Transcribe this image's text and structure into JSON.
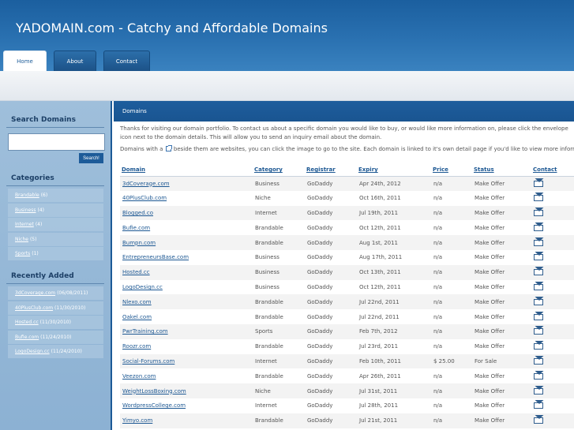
{
  "header": {
    "title": "YADOMAIN.com - Catchy and Affordable Domains",
    "tabs": [
      {
        "label": "Home",
        "active": true
      },
      {
        "label": "About",
        "active": false
      },
      {
        "label": "Contact",
        "active": false
      }
    ]
  },
  "sidebar": {
    "search": {
      "heading": "Search Domains",
      "placeholder": "",
      "button_label": "Search!"
    },
    "categories": {
      "heading": "Categories",
      "items": [
        {
          "label": "Brandable",
          "count": "(6)"
        },
        {
          "label": "Business",
          "count": "(4)"
        },
        {
          "label": "Internet",
          "count": "(4)"
        },
        {
          "label": "Niche",
          "count": "(5)"
        },
        {
          "label": "Sports",
          "count": "(1)"
        }
      ]
    },
    "recent": {
      "heading": "Recently Added",
      "items": [
        {
          "label": "3dCoverage.com",
          "date": "(06/08/2011)"
        },
        {
          "label": "40PlusClub.com",
          "date": "(11/30/2010)"
        },
        {
          "label": "Hosted.cc",
          "date": "(11/30/2010)"
        },
        {
          "label": "Bufie.com",
          "date": "(11/24/2010)"
        },
        {
          "label": "LogoDesign.cc",
          "date": "(11/24/2010)"
        }
      ]
    }
  },
  "main": {
    "bar_title": "Domains",
    "intro": "Thanks for visiting our domain portfolio. To contact us about a specific domain you would like to buy, or would like more information on, please click the envelope icon next to the domain details. This will allow you to send an inquiry email about the domain.",
    "note_before": "Domains with a",
    "note_after": "beside them are websites, you can click the image to go to the site. Each domain is linked to it's own detail page if you'd like to view more information.",
    "columns": [
      "Domain",
      "Category",
      "Registrar",
      "Expiry",
      "Price",
      "Status",
      "Contact"
    ],
    "rows": [
      {
        "domain": "3dCoverage.com",
        "category": "Business",
        "registrar": "GoDaddy",
        "expiry": "Apr 24th, 2012",
        "price": "n/a",
        "status": "Make Offer"
      },
      {
        "domain": "40PlusClub.com",
        "category": "Niche",
        "registrar": "GoDaddy",
        "expiry": "Oct 16th, 2011",
        "price": "n/a",
        "status": "Make Offer"
      },
      {
        "domain": "Blogged.co",
        "category": "Internet",
        "registrar": "GoDaddy",
        "expiry": "Jul 19th, 2011",
        "price": "n/a",
        "status": "Make Offer"
      },
      {
        "domain": "Bufie.com",
        "category": "Brandable",
        "registrar": "GoDaddy",
        "expiry": "Oct 12th, 2011",
        "price": "n/a",
        "status": "Make Offer"
      },
      {
        "domain": "Bumpn.com",
        "category": "Brandable",
        "registrar": "GoDaddy",
        "expiry": "Aug 1st, 2011",
        "price": "n/a",
        "status": "Make Offer"
      },
      {
        "domain": "EntrepreneursBase.com",
        "category": "Business",
        "registrar": "GoDaddy",
        "expiry": "Aug 17th, 2011",
        "price": "n/a",
        "status": "Make Offer"
      },
      {
        "domain": "Hosted.cc",
        "category": "Business",
        "registrar": "GoDaddy",
        "expiry": "Oct 13th, 2011",
        "price": "n/a",
        "status": "Make Offer"
      },
      {
        "domain": "LogoDesign.cc",
        "category": "Business",
        "registrar": "GoDaddy",
        "expiry": "Oct 12th, 2011",
        "price": "n/a",
        "status": "Make Offer"
      },
      {
        "domain": "Nlexo.com",
        "category": "Brandable",
        "registrar": "GoDaddy",
        "expiry": "Jul 22nd, 2011",
        "price": "n/a",
        "status": "Make Offer"
      },
      {
        "domain": "Oakel.com",
        "category": "Brandable",
        "registrar": "GoDaddy",
        "expiry": "Jul 22nd, 2011",
        "price": "n/a",
        "status": "Make Offer"
      },
      {
        "domain": "PwrTraining.com",
        "category": "Sports",
        "registrar": "GoDaddy",
        "expiry": "Feb 7th, 2012",
        "price": "n/a",
        "status": "Make Offer"
      },
      {
        "domain": "Roozr.com",
        "category": "Brandable",
        "registrar": "GoDaddy",
        "expiry": "Jul 23rd, 2011",
        "price": "n/a",
        "status": "Make Offer"
      },
      {
        "domain": "Social-Forums.com",
        "category": "Internet",
        "registrar": "GoDaddy",
        "expiry": "Feb 10th, 2011",
        "price": "$ 25.00",
        "status": "For Sale"
      },
      {
        "domain": "Veezon.com",
        "category": "Brandable",
        "registrar": "GoDaddy",
        "expiry": "Apr 26th, 2011",
        "price": "n/a",
        "status": "Make Offer"
      },
      {
        "domain": "WeightLossBoxing.com",
        "category": "Niche",
        "registrar": "GoDaddy",
        "expiry": "Jul 31st, 2011",
        "price": "n/a",
        "status": "Make Offer"
      },
      {
        "domain": "WordpressCollege.com",
        "category": "Internet",
        "registrar": "GoDaddy",
        "expiry": "Jul 28th, 2011",
        "price": "n/a",
        "status": "Make Offer"
      },
      {
        "domain": "Yimyo.com",
        "category": "Brandable",
        "registrar": "GoDaddy",
        "expiry": "Jul 21st, 2011",
        "price": "n/a",
        "status": "Make Offer"
      }
    ]
  },
  "icons": {
    "contact": "envelope-icon",
    "website": "external-link-icon"
  },
  "colors": {
    "header_blue": "#1b5f9f",
    "sidebar_blue": "#9fbfdb",
    "link_blue": "#1d5893",
    "row_alt": "#f3f3f3"
  }
}
